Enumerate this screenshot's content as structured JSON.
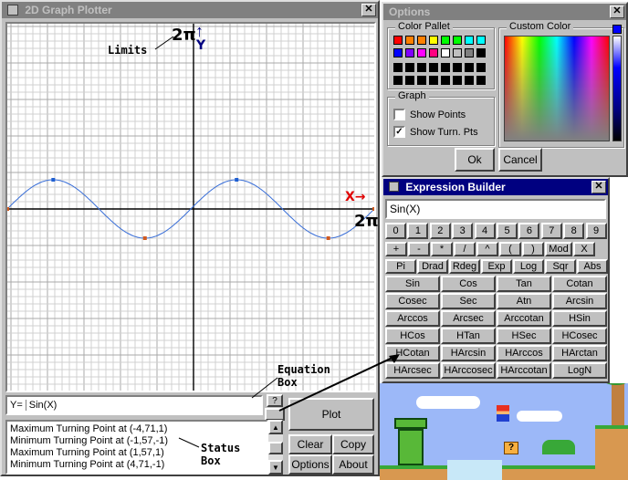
{
  "plotter": {
    "title": "2D Graph Plotter",
    "close": "✕",
    "annotation_limits": "Limits",
    "annotation_2pi_top": "2π",
    "annotation_y": "Y",
    "annotation_x": "X",
    "annotation_2pi_right": "2π",
    "y_label": "Y=",
    "equation": "Sin(X)",
    "help_button": "?",
    "plot_button": "Plot",
    "clear_button": "Clear",
    "copy_button": "Copy",
    "options_button": "Options",
    "about_button": "About",
    "annotation_equation_box": "Equation\nBox",
    "annotation_status_box": "Status\nBox",
    "status_lines": [
      "Maximum Turning Point at (-4,71,1)",
      "Minimum Turning Point at (-1,57,-1)",
      "Maximum Turning Point at (1,57,1)",
      "Minimum Turning Point at (4,71,-1)"
    ],
    "curve_color": "#3a6fd8",
    "point_color_max": "#1f5fd0",
    "point_color_min": "#d05a20"
  },
  "options": {
    "title": "Options",
    "close": "✕",
    "color_pallet_label": "Color Pallet",
    "custom_color_label": "Custom Color",
    "graph_label": "Graph",
    "show_points_label": "Show Points",
    "show_points_checked": false,
    "show_turn_label": "Show Turn. Pts",
    "show_turn_checked": true,
    "ok_button": "Ok",
    "cancel_button": "Cancel",
    "palette_row1": [
      "#ff0000",
      "#ff8000",
      "#ff8000",
      "#ffff00",
      "#00ff00",
      "#00ff00",
      "#00ffff",
      "#00ffff"
    ],
    "palette_row2": [
      "#0000ff",
      "#8000ff",
      "#ff00ff",
      "#ff0080",
      "#ffffff",
      "#c0c0c0",
      "#808080",
      "#000000"
    ]
  },
  "expr": {
    "title": "Expression Builder",
    "close": "✕",
    "input": "Sin(X)",
    "digits": [
      "0",
      "1",
      "2",
      "3",
      "4",
      "5",
      "6",
      "7",
      "8",
      "9"
    ],
    "ops": [
      "+",
      "-",
      "*",
      "/",
      "^",
      "(",
      ")",
      "Mod",
      "X"
    ],
    "row3": [
      "Pi",
      "Drad",
      "Rdeg",
      "Exp",
      "Log",
      "Sqr",
      "Abs"
    ],
    "funcs": [
      [
        "Sin",
        "Cos",
        "Tan",
        "Cotan"
      ],
      [
        "Cosec",
        "Sec",
        "Atn",
        "Arcsin"
      ],
      [
        "Arccos",
        "Arcsec",
        "Arccotan",
        "HSin"
      ],
      [
        "HCos",
        "HTan",
        "HSec",
        "HCosec"
      ],
      [
        "HCotan",
        "HArcsin",
        "HArccos",
        "HArctan"
      ],
      [
        "HArcsec",
        "HArccosec",
        "HArccotan",
        "LogN"
      ]
    ]
  }
}
